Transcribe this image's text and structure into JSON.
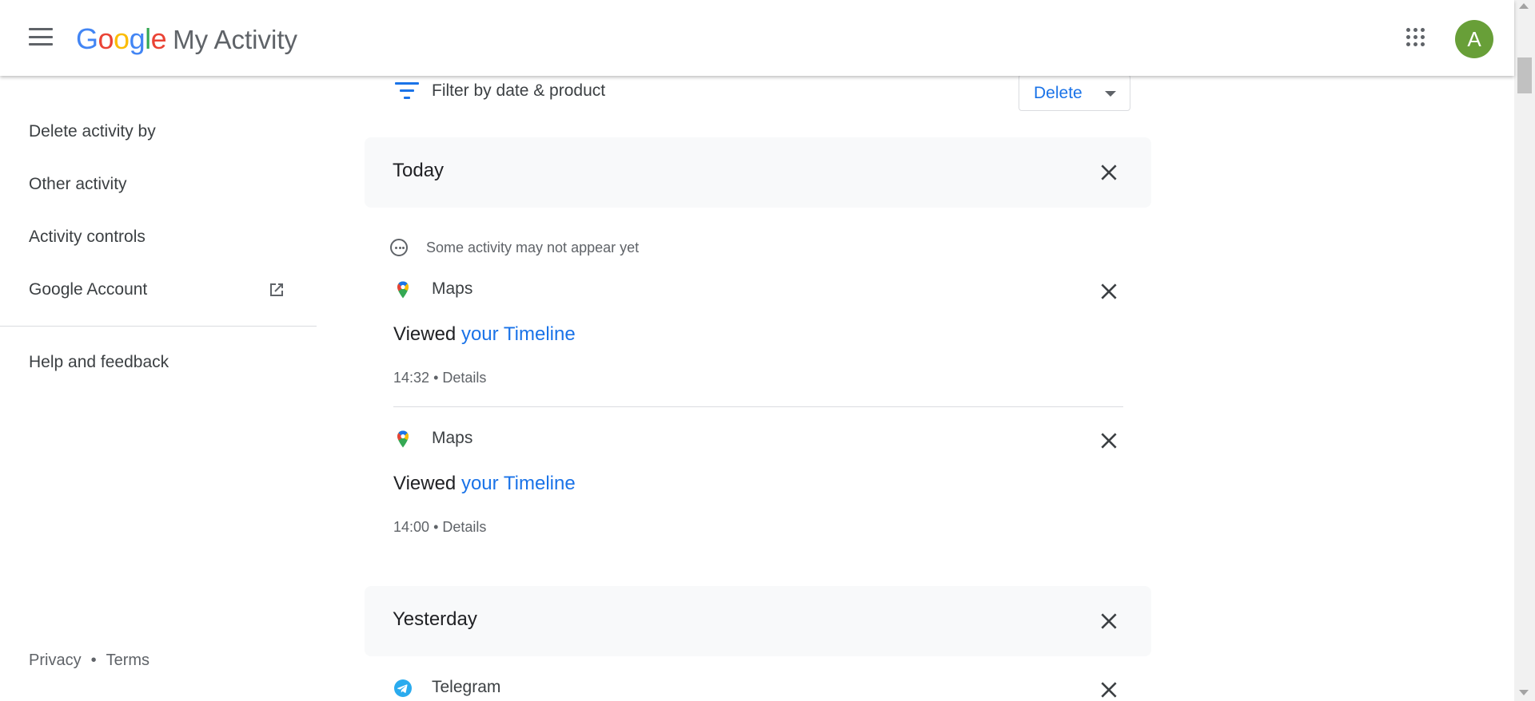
{
  "header": {
    "logo": {
      "G": "G",
      "o1": "o",
      "o2": "o",
      "g": "g",
      "l": "l",
      "e": "e",
      "product": "My Activity"
    },
    "avatar_letter": "A",
    "colors": {
      "google_blue": "#4285F4",
      "google_red": "#EA4335",
      "google_yellow": "#FBBC05",
      "google_green": "#34A853",
      "avatar": "#689f38"
    }
  },
  "sidebar": {
    "items": [
      {
        "label": "Delete activity by"
      },
      {
        "label": "Other activity"
      },
      {
        "label": "Activity controls"
      },
      {
        "label": "Google Account"
      },
      {
        "label": "Help and feedback"
      }
    ],
    "footer": {
      "privacy": "Privacy",
      "separator": "•",
      "terms": "Terms"
    }
  },
  "toolbar": {
    "filter_label": "Filter by date & product",
    "delete_label": "Delete",
    "accent": "#1a73e8"
  },
  "days": [
    {
      "title": "Today",
      "notice": "Some activity may not appear yet",
      "items": [
        {
          "product": "Maps",
          "action": "Viewed",
          "link": "your Timeline",
          "time": "14:32",
          "sep": "•",
          "details": "Details"
        },
        {
          "product": "Maps",
          "action": "Viewed",
          "link": "your Timeline",
          "time": "14:00",
          "sep": "•",
          "details": "Details"
        }
      ]
    },
    {
      "title": "Yesterday",
      "items": [
        {
          "product": "Telegram"
        }
      ]
    }
  ]
}
